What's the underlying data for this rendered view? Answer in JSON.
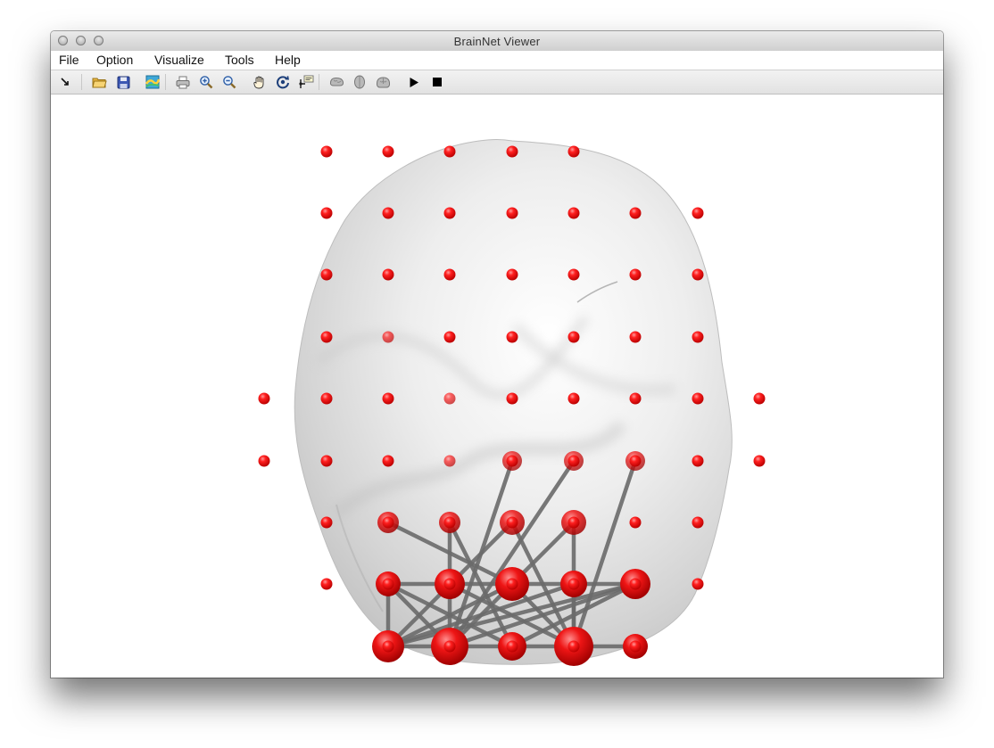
{
  "window": {
    "title": "BrainNet Viewer"
  },
  "menu": [
    "File",
    "Option",
    "Visualize",
    "Tools",
    "Help"
  ],
  "toolbar": [
    {
      "name": "arrow-pointer-icon"
    },
    {
      "name": "open-folder-icon"
    },
    {
      "name": "save-disk-icon"
    },
    {
      "name": "colorbar-map-icon"
    },
    {
      "name": "print-icon"
    },
    {
      "name": "zoom-in-icon"
    },
    {
      "name": "zoom-out-icon"
    },
    {
      "name": "pan-hand-icon"
    },
    {
      "name": "rotate-3d-icon"
    },
    {
      "name": "data-cursor-icon"
    },
    {
      "name": "sagittal-view-icon"
    },
    {
      "name": "axial-view-icon"
    },
    {
      "name": "coronal-view-icon"
    },
    {
      "name": "play-icon"
    },
    {
      "name": "stop-icon"
    }
  ],
  "colors": {
    "node": "#ff1a1a",
    "edge": "#6b6b6b",
    "brain_surface": "#e6e6e6"
  }
}
